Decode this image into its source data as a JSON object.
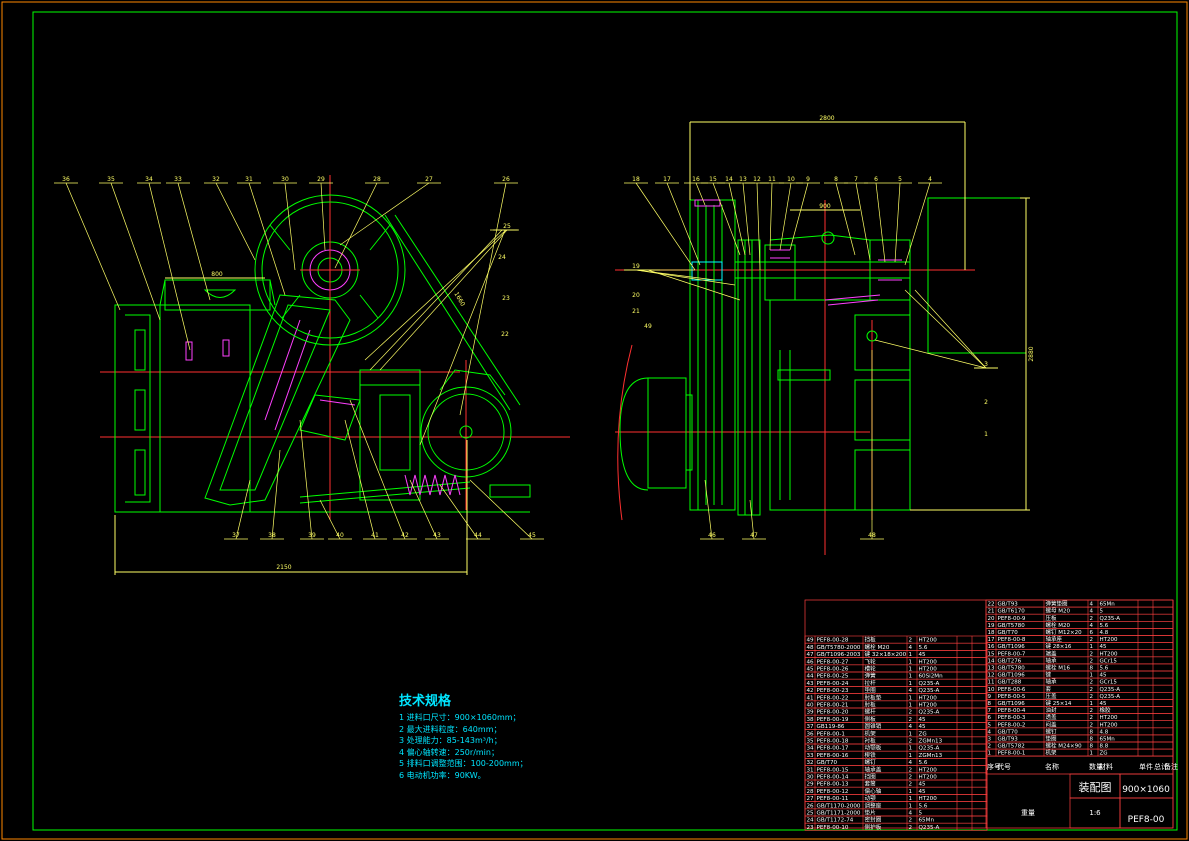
{
  "colors": {
    "background": "#000000",
    "frame": "#00ff00",
    "outline": "#00ff00",
    "centerline": "#ff3030",
    "leader": "#ffff66",
    "hatch": "#ff40ff",
    "spec_text": "#00e5ff",
    "table_grid": "#ff4040",
    "table_text": "#ffffff"
  },
  "tech_spec": {
    "title": "技术规格",
    "items": [
      "1 进料口尺寸：900×1060mm；",
      "2 最大进料粒度：640mm；",
      "3 处理能力：85-143m³/h；",
      "4 偏心轴转速：250r/min；",
      "5 排料口调整范围：100-200mm；",
      "6 电动机功率：90KW。"
    ]
  },
  "left_view": {
    "callouts_top": [
      "36",
      "35",
      "34",
      "33",
      "32",
      "31",
      "30",
      "29",
      "28",
      "27",
      "26"
    ],
    "callouts_right": [
      "25",
      "24",
      "23",
      "22"
    ],
    "callouts_bottom": [
      "37",
      "38",
      "39",
      "40",
      "41",
      "42",
      "43",
      "44",
      "45"
    ],
    "dim_width": "2150",
    "dim_inner": "800",
    "dim_diag": "1660"
  },
  "right_view": {
    "callouts_top": [
      "18",
      "17",
      "16",
      "15",
      "14",
      "13",
      "12",
      "11",
      "10",
      "9",
      "8",
      "7",
      "6",
      "5",
      "4"
    ],
    "callouts_left": [
      "19",
      "20",
      "21",
      "49"
    ],
    "callouts_right": [
      "3",
      "2",
      "1"
    ],
    "callouts_bottom": [
      "46",
      "47",
      "48"
    ],
    "dim_width": "2800",
    "dim_inner": "900",
    "dim_height": "2880"
  },
  "title_block": {
    "drawing_title": "装配图",
    "spec": "900×1060",
    "drawing_no": "PEF8-00",
    "scale": "1:6",
    "header_cols": [
      "序号",
      "代号",
      "名称",
      "数量",
      "材料",
      "单件",
      "总计",
      "备注"
    ],
    "weight_label": "重量",
    "parts_left": [
      {
        "no": "49",
        "code": "PEF8-00-28",
        "name": "挡板",
        "qty": "2",
        "mat": "HT200"
      },
      {
        "no": "48",
        "code": "GB/T5780-2000",
        "name": "螺栓 M20",
        "qty": "4",
        "mat": "5.6"
      },
      {
        "no": "47",
        "code": "GB/T1096-2003",
        "name": "键 32×18×200",
        "qty": "1",
        "mat": "45"
      },
      {
        "no": "46",
        "code": "PEF8-00-27",
        "name": "飞轮",
        "qty": "1",
        "mat": "HT200"
      },
      {
        "no": "45",
        "code": "PEF8-00-26",
        "name": "槽轮",
        "qty": "1",
        "mat": "HT200"
      },
      {
        "no": "44",
        "code": "PEF8-00-25",
        "name": "弹簧",
        "qty": "1",
        "mat": "60Si2Mn"
      },
      {
        "no": "43",
        "code": "PEF8-00-24",
        "name": "拉杆",
        "qty": "1",
        "mat": "Q235-A"
      },
      {
        "no": "42",
        "code": "PEF8-00-23",
        "name": "垫圈",
        "qty": "4",
        "mat": "Q235-A"
      },
      {
        "no": "41",
        "code": "PEF8-00-22",
        "name": "肘板垫",
        "qty": "1",
        "mat": "HT200"
      },
      {
        "no": "40",
        "code": "PEF8-00-21",
        "name": "肘板",
        "qty": "1",
        "mat": "HT200"
      },
      {
        "no": "39",
        "code": "PEF8-00-20",
        "name": "螺杆",
        "qty": "2",
        "mat": "Q235-A"
      },
      {
        "no": "38",
        "code": "PEF8-00-19",
        "name": "侧板",
        "qty": "2",
        "mat": "45"
      },
      {
        "no": "37",
        "code": "GB119-86",
        "name": "圆锥销",
        "qty": "4",
        "mat": "45"
      },
      {
        "no": "36",
        "code": "PEF8-00-1",
        "name": "机架",
        "qty": "1",
        "mat": "ZG"
      },
      {
        "no": "35",
        "code": "PEF8-00-18",
        "name": "衬板",
        "qty": "2",
        "mat": "ZGMn13"
      },
      {
        "no": "34",
        "code": "PEF8-00-17",
        "name": "动颚板",
        "qty": "1",
        "mat": "Q235-A"
      },
      {
        "no": "33",
        "code": "PEF8-00-16",
        "name": "楔铁",
        "qty": "1",
        "mat": "ZGMn13"
      },
      {
        "no": "32",
        "code": "GB/T70",
        "name": "螺钉",
        "qty": "4",
        "mat": "5.6"
      },
      {
        "no": "31",
        "code": "PEF8-00-15",
        "name": "轴承盖",
        "qty": "2",
        "mat": "HT200"
      },
      {
        "no": "30",
        "code": "PEF8-00-14",
        "name": "挡圈",
        "qty": "2",
        "mat": "HT200"
      },
      {
        "no": "29",
        "code": "PEF8-00-13",
        "name": "套筒",
        "qty": "2",
        "mat": "45"
      },
      {
        "no": "28",
        "code": "PEF8-00-12",
        "name": "偏心轴",
        "qty": "1",
        "mat": "45"
      },
      {
        "no": "27",
        "code": "PEF8-00-11",
        "name": "动颚",
        "qty": "1",
        "mat": "HT200"
      },
      {
        "no": "26",
        "code": "GB/T1170-2000",
        "name": "调整座",
        "qty": "1",
        "mat": "5.6"
      },
      {
        "no": "25",
        "code": "GB/T1171-2000",
        "name": "垫片",
        "qty": "4",
        "mat": "5"
      },
      {
        "no": "24",
        "code": "GB/T1172-74",
        "name": "密封圈",
        "qty": "2",
        "mat": "65Mn"
      },
      {
        "no": "23",
        "code": "PEF8-00-10",
        "name": "侧护板",
        "qty": "2",
        "mat": "Q235-A"
      }
    ],
    "parts_right": [
      {
        "no": "22",
        "code": "GB/T93",
        "name": "弹簧垫圈",
        "qty": "4",
        "mat": "65Mn"
      },
      {
        "no": "21",
        "code": "GB/T6170",
        "name": "螺母 M20",
        "qty": "4",
        "mat": "5"
      },
      {
        "no": "20",
        "code": "PEF8-00-9",
        "name": "压板",
        "qty": "2",
        "mat": "Q235-A"
      },
      {
        "no": "19",
        "code": "GB/T5780",
        "name": "螺栓 M20",
        "qty": "4",
        "mat": "5.6"
      },
      {
        "no": "18",
        "code": "GB/T70",
        "name": "螺钉 M12×20",
        "qty": "6",
        "mat": "4.8"
      },
      {
        "no": "17",
        "code": "PEF8-00-8",
        "name": "轴承座",
        "qty": "2",
        "mat": "HT200"
      },
      {
        "no": "16",
        "code": "GB/T1096",
        "name": "键 28×16",
        "qty": "1",
        "mat": "45"
      },
      {
        "no": "15",
        "code": "PEF8-00-7",
        "name": "端盖",
        "qty": "2",
        "mat": "HT200"
      },
      {
        "no": "14",
        "code": "GB/T276",
        "name": "轴承",
        "qty": "2",
        "mat": "GCr15"
      },
      {
        "no": "13",
        "code": "GB/T5780",
        "name": "螺栓 M16",
        "qty": "8",
        "mat": "5.6"
      },
      {
        "no": "12",
        "code": "GB/T1096",
        "name": "键",
        "qty": "1",
        "mat": "45"
      },
      {
        "no": "11",
        "code": "GB/T288",
        "name": "轴承",
        "qty": "2",
        "mat": "GCr15"
      },
      {
        "no": "10",
        "code": "PEF8-00-6",
        "name": "套",
        "qty": "2",
        "mat": "Q235-A"
      },
      {
        "no": "9",
        "code": "PEF8-00-5",
        "name": "压盖",
        "qty": "2",
        "mat": "Q235-A"
      },
      {
        "no": "8",
        "code": "GB/T1096",
        "name": "键 25×14",
        "qty": "1",
        "mat": "45"
      },
      {
        "no": "7",
        "code": "PEF8-00-4",
        "name": "油封",
        "qty": "2",
        "mat": "橡胶"
      },
      {
        "no": "6",
        "code": "PEF8-00-3",
        "name": "透盖",
        "qty": "2",
        "mat": "HT200"
      },
      {
        "no": "5",
        "code": "PEF8-00-2",
        "name": "闷盖",
        "qty": "2",
        "mat": "HT200"
      },
      {
        "no": "4",
        "code": "GB/T70",
        "name": "螺钉",
        "qty": "8",
        "mat": "4.8"
      },
      {
        "no": "3",
        "code": "GB/T93",
        "name": "垫圈",
        "qty": "8",
        "mat": "65Mn"
      },
      {
        "no": "2",
        "code": "GB/T5782",
        "name": "螺栓 M24×90",
        "qty": "8",
        "mat": "8.8"
      },
      {
        "no": "1",
        "code": "PEF8-00-1",
        "name": "机架",
        "qty": "1",
        "mat": "ZG"
      }
    ]
  }
}
